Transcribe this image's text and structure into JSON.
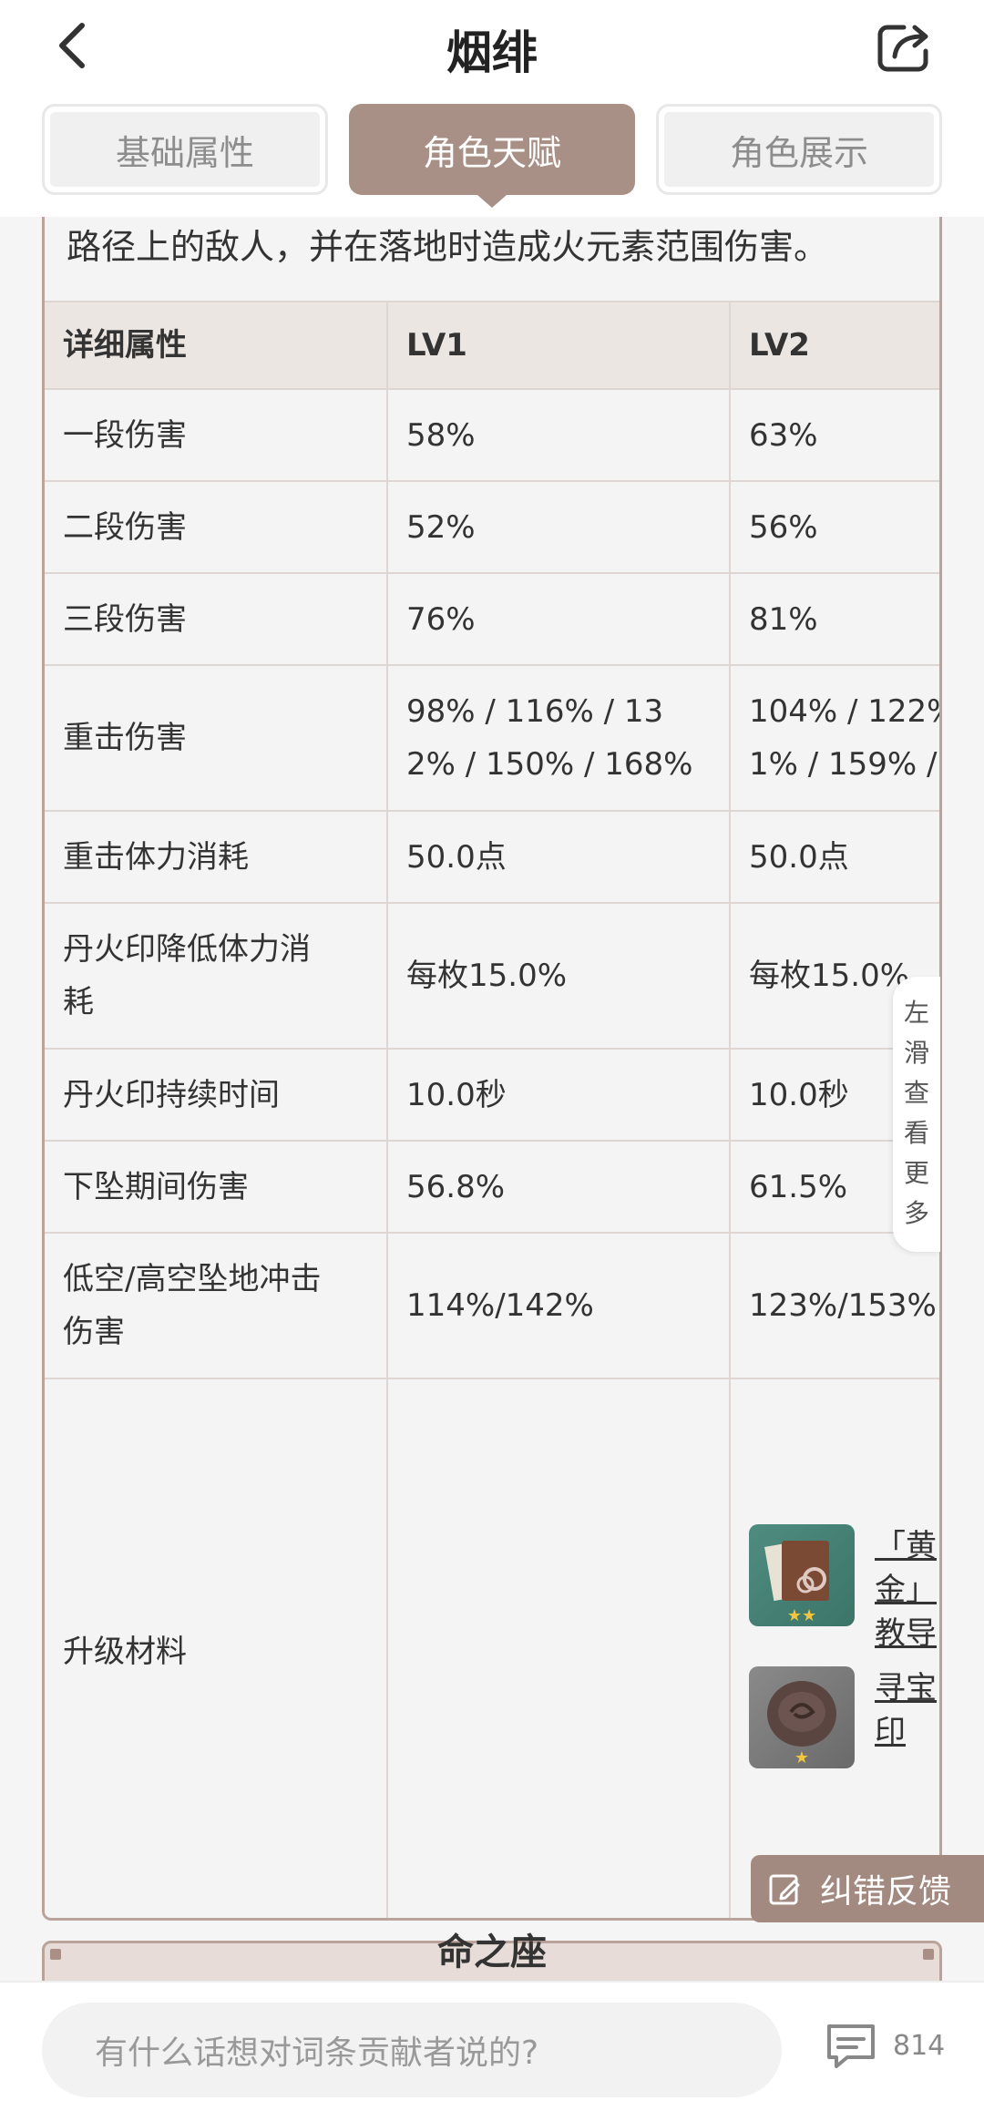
{
  "header": {
    "title": "烟绯"
  },
  "tabs": [
    {
      "label": "基础属性",
      "active": false
    },
    {
      "label": "角色天赋",
      "active": true
    },
    {
      "label": "角色展示",
      "active": false
    }
  ],
  "description_tail": "路径上的敌人，并在落地时造成火元素范围伤害。",
  "table": {
    "headers": [
      "详细属性",
      "LV1",
      "LV2"
    ],
    "rows": [
      {
        "label": "一段伤害",
        "lv1": "58%",
        "lv2": "63%"
      },
      {
        "label": "二段伤害",
        "lv1": "52%",
        "lv2": "56%"
      },
      {
        "label": "三段伤害",
        "lv1": "76%",
        "lv2": "81%"
      },
      {
        "label": "重击伤害",
        "lv1_line1": "98% / 116% / 13",
        "lv1_line2": "2% / 150% / 168%",
        "lv2_line1": "104% / 122%",
        "lv2_line2": "1% / 159% /"
      },
      {
        "label": "重击体力消耗",
        "lv1": "50.0点",
        "lv2": "50.0点"
      },
      {
        "label_line1": "丹火印降低体力消",
        "label_line2": "耗",
        "lv1": "每枚15.0%",
        "lv2": "每枚15.0%"
      },
      {
        "label": "丹火印持续时间",
        "lv1": "10.0秒",
        "lv2": "10.0秒"
      },
      {
        "label": "下坠期间伤害",
        "lv1": "56.8%",
        "lv2": "61.5%"
      },
      {
        "label_line1": "低空/高空坠地冲击",
        "label_line2": "伤害",
        "lv1": "114%/142%",
        "lv2": "123%/153%"
      },
      {
        "label": "升级材料"
      }
    ],
    "materials_lv2": [
      {
        "name_lines": [
          "「黄",
          "金」",
          "教导"
        ],
        "stars": "★★"
      },
      {
        "name_lines": [
          "寻宝",
          "印"
        ],
        "stars": "★"
      }
    ]
  },
  "swipe_hint": [
    "左",
    "滑",
    "查",
    "看",
    "更",
    "多"
  ],
  "feedback_label": "纠错反馈",
  "next_section_title": "命之座",
  "bottom_bar": {
    "comment_placeholder": "有什么话想对词条贡献者说的?",
    "comment_count": "814"
  }
}
